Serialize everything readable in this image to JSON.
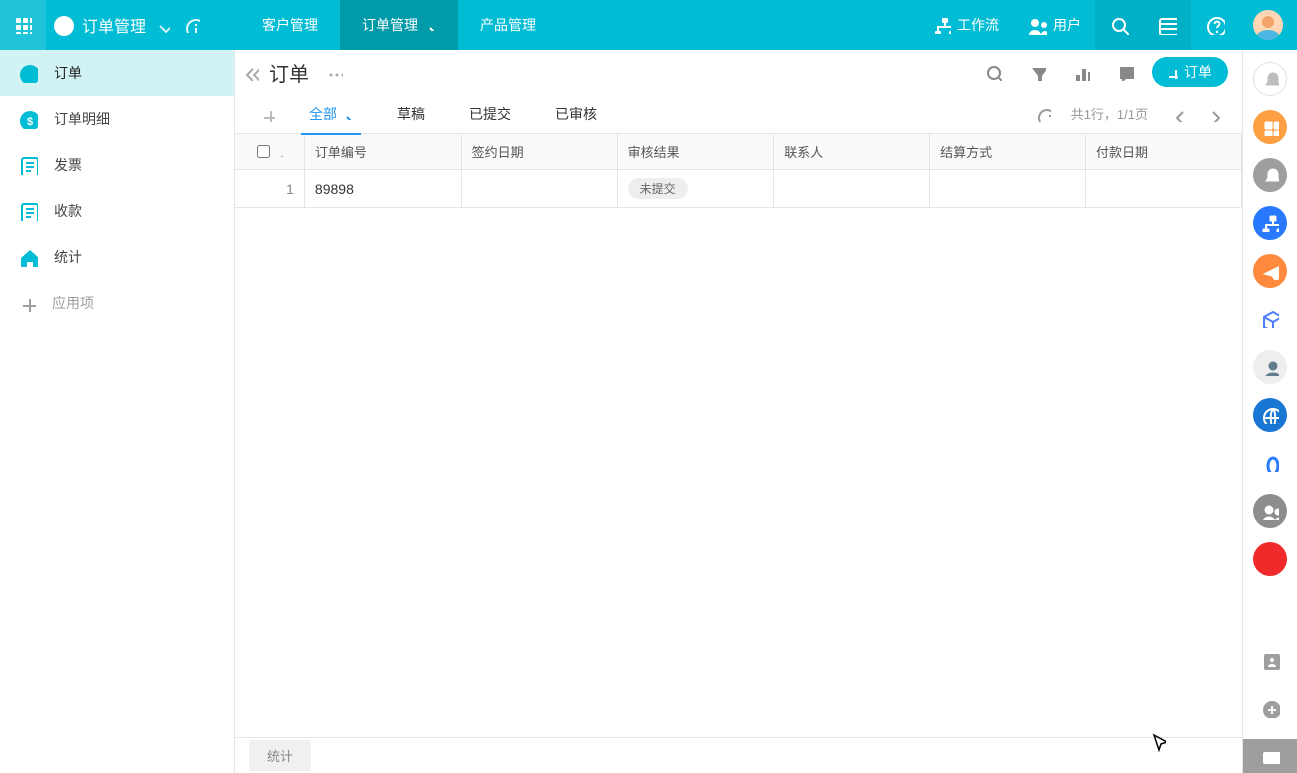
{
  "header": {
    "app_title": "订单管理",
    "tabs": [
      "客户管理",
      "订单管理",
      "产品管理"
    ],
    "active_tab_index": 1,
    "workflow_label": "工作流",
    "users_label": "用户"
  },
  "sidebar": {
    "items": [
      {
        "label": "订单",
        "icon": "currency"
      },
      {
        "label": "订单明细",
        "icon": "currency-badge"
      },
      {
        "label": "发票",
        "icon": "document-list"
      },
      {
        "label": "收款",
        "icon": "document-list"
      },
      {
        "label": "统计",
        "icon": "home"
      }
    ],
    "active_index": 0,
    "add_item_label": "应用项"
  },
  "page": {
    "title": "订单",
    "create_button_label": "订单",
    "tabs": [
      "全部",
      "草稿",
      "已提交",
      "已审核"
    ],
    "active_tab_index": 0,
    "pagination_text": "共1行，1/1页",
    "footer_tab_label": "统计"
  },
  "table": {
    "columns": [
      "订单编号",
      "签约日期",
      "审核结果",
      "联系人",
      "结算方式",
      "付款日期"
    ],
    "rows": [
      {
        "row_number": "1",
        "订单编号": "89898",
        "签约日期": "",
        "审核结果": "未提交",
        "联系人": "",
        "结算方式": "",
        "付款日期": ""
      }
    ]
  },
  "dock_icons": [
    {
      "name": "notifications-outline-icon",
      "bg": "#ffffff",
      "fg": "#bdbdbd",
      "shape": "bell",
      "border": true
    },
    {
      "name": "apps-icon",
      "bg": "#ff9f43",
      "fg": "#ffffff",
      "shape": "grid"
    },
    {
      "name": "notifications-icon",
      "bg": "#9e9e9e",
      "fg": "#ffffff",
      "shape": "bell"
    },
    {
      "name": "sitemap-icon",
      "bg": "#2979ff",
      "fg": "#ffffff",
      "shape": "sitemap"
    },
    {
      "name": "send-icon",
      "bg": "#ff8a3d",
      "fg": "#ffffff",
      "shape": "send"
    },
    {
      "name": "cube-icon",
      "bg": "#ffffff",
      "fg": "#4e7cff",
      "shape": "cube",
      "border": false
    },
    {
      "name": "support-icon",
      "bg": "#eeeeee",
      "fg": "#607d8b",
      "shape": "person"
    },
    {
      "name": "globe-icon",
      "bg": "#1976d2",
      "fg": "#ffffff",
      "shape": "globe"
    },
    {
      "name": "zero-icon",
      "bg": "#ffffff",
      "fg": "#2979ff",
      "shape": "zero",
      "border": false
    },
    {
      "name": "group-icon",
      "bg": "#8d8d8d",
      "fg": "#ffffff",
      "shape": "group"
    },
    {
      "name": "record-icon",
      "bg": "#f02a2a",
      "fg": "#ffffff",
      "shape": "dot"
    }
  ]
}
